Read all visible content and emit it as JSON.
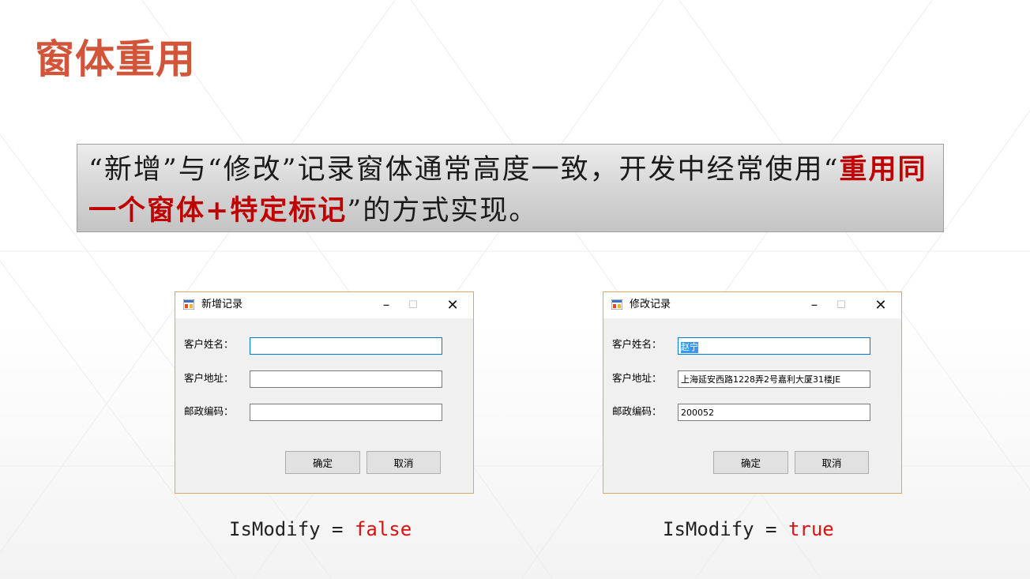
{
  "slide": {
    "title": "窗体重用",
    "callout": {
      "part1": "“新增”与“修改”记录窗体通常高度一致，开发中经常使用“",
      "highlight": "重用同一个窗体+特定标记",
      "part2": "”的方式实现。",
      "highlight_color": "#c00000"
    },
    "title_color": "#d2553a"
  },
  "add_window": {
    "title": "新增记录",
    "name_label": "客户姓名：",
    "address_label": "客户地址：",
    "zip_label": "邮政编码：",
    "name_value": "",
    "address_value": "",
    "zip_value": "",
    "ok_label": "确定",
    "cancel_label": "取消",
    "caption_prefix": "IsModify = ",
    "caption_value": "false"
  },
  "edit_window": {
    "title": "修改记录",
    "name_label": "客户姓名：",
    "address_label": "客户地址：",
    "zip_label": "邮政编码：",
    "name_value": "赵宁",
    "address_value": "上海延安西路1228弄2号嘉利大厦31楼JE",
    "zip_value": "200052",
    "ok_label": "确定",
    "cancel_label": "取消",
    "caption_prefix": "IsModify = ",
    "caption_value": "true"
  },
  "icons": {
    "app": "form-app-icon",
    "minimize": "minimize-icon",
    "maximize": "maximize-icon",
    "close": "close-icon"
  },
  "window_controls": {
    "minimize": "–",
    "maximize": "☐",
    "close": "✕"
  }
}
